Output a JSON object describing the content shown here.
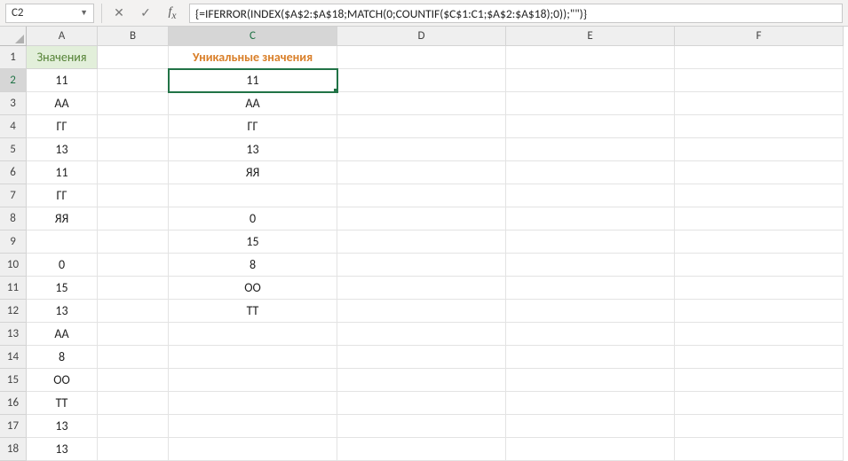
{
  "formula_bar": {
    "cell_ref": "C2",
    "formula": "{=IFERROR(INDEX($A$2:$A$18;MATCH(0;COUNTIF($C$1:C1;$A$2:$A$18);0));\"\")}"
  },
  "columns": [
    "A",
    "B",
    "C",
    "D",
    "E",
    "F"
  ],
  "row_count": 18,
  "active_cell": {
    "row": 2,
    "col": "C"
  },
  "headers": {
    "A": "Значения",
    "C": "Уникальные значения"
  },
  "data": {
    "A": {
      "2": "11",
      "3": "АА",
      "4": "ГГ",
      "5": "13",
      "6": "11",
      "7": "ГГ",
      "8": "ЯЯ",
      "9": "",
      "10": "0",
      "11": "15",
      "12": "13",
      "13": "АА",
      "14": "8",
      "15": "ОО",
      "16": "ТТ",
      "17": "13",
      "18": "13"
    },
    "C": {
      "2": "11",
      "3": "АА",
      "4": "ГГ",
      "5": "13",
      "6": "ЯЯ",
      "7": "",
      "8": "0",
      "9": "15",
      "10": "8",
      "11": "ОО",
      "12": "ТТ"
    }
  }
}
